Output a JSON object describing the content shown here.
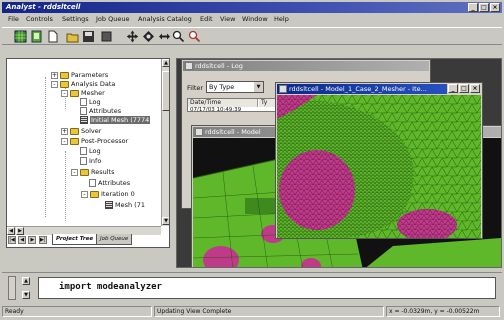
{
  "window": {
    "title": "Analyst - rddsltcell"
  },
  "menu": [
    "File",
    "Controls",
    "Settings",
    "Job Queue",
    "Analysis Catalog",
    "Edit",
    "View",
    "Window",
    "Help"
  ],
  "toolbar": {
    "icons": [
      "green-grid-icon",
      "document-icon",
      "new-icon",
      "open-icon",
      "save-icon",
      "stop-icon",
      "move-icon",
      "rotate-icon",
      "pan-icon",
      "zoom-in-icon",
      "zoom-out-icon"
    ]
  },
  "tree": {
    "items": [
      {
        "label": "Parameters"
      },
      {
        "label": "Analysis Data"
      },
      {
        "label": "Mesher"
      },
      {
        "label": "Log"
      },
      {
        "label": "Attributes"
      },
      {
        "label": "Initial Mesh (7774"
      },
      {
        "label": "Solver"
      },
      {
        "label": "Post-Processor"
      },
      {
        "label": "Log"
      },
      {
        "label": "Info"
      },
      {
        "label": "Results"
      },
      {
        "label": "Attributes"
      },
      {
        "label": "Iteration 0"
      },
      {
        "label": "Mesh (71"
      }
    ],
    "tabs": [
      "Project Tree",
      "Job Queue"
    ]
  },
  "windows": {
    "log": {
      "title": "rddsltcell - Log",
      "filter_label": "Filter",
      "filter_value": "By Type",
      "col_date": "Date/Time",
      "col_type": "Ty",
      "row_date": "07/17/03 10:49:39"
    },
    "meshview_back": {
      "title": "rddsltcell - Model"
    },
    "meshview_front": {
      "title": "rddsltcell - Model_1_Case_2_Mesher - Ite..."
    }
  },
  "command": {
    "prompt": "import modeanalyzer"
  },
  "status": {
    "state": "Ready",
    "message": "Updating View Complete",
    "coords": "x = -0.0329m, y = -0.00522m"
  },
  "colors": {
    "accent": "#1a2a8c",
    "mesh_green": "#5fb82a",
    "mesh_magenta": "#c03a8a"
  }
}
